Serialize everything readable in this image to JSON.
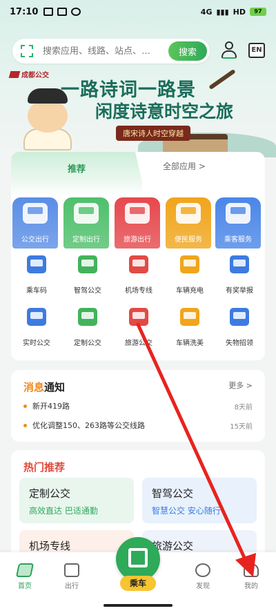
{
  "status": {
    "time": "17:10",
    "network": "4G",
    "hd": "HD",
    "battery": "97"
  },
  "search": {
    "placeholder": "搜索应用、线路、站点、…",
    "button": "搜索",
    "lang": "EN"
  },
  "banner": {
    "logo": "成都公交",
    "title_line1": "一路诗词一路景",
    "title_line2": "闲度诗意时空之旅",
    "subtitle": "唐宋诗人时空穿越"
  },
  "tabs": {
    "recommend": "推荐",
    "all": "全部应用 >"
  },
  "featured": [
    {
      "label": "公交出行",
      "color": "#5a8ee6"
    },
    {
      "label": "定制出行",
      "color": "#4fbf6c"
    },
    {
      "label": "旅游出行",
      "color": "#e5484d"
    },
    {
      "label": "便民服务",
      "color": "#f0a51c"
    },
    {
      "label": "乘客服务",
      "color": "#4a86e8"
    }
  ],
  "services_row1": [
    {
      "label": "乘车码",
      "color": "#3d7be0"
    },
    {
      "label": "智驾公交",
      "color": "#43b35b"
    },
    {
      "label": "机场专线",
      "color": "#e24a44"
    },
    {
      "label": "车辆充电",
      "color": "#f0a51c"
    },
    {
      "label": "有奖举报",
      "color": "#3d7be0"
    }
  ],
  "services_row2": [
    {
      "label": "实时公交",
      "color": "#3d7be0"
    },
    {
      "label": "定制公交",
      "color": "#43b35b"
    },
    {
      "label": "旅游公交",
      "color": "#e24a44"
    },
    {
      "label": "车辆洗美",
      "color": "#f0a51c"
    },
    {
      "label": "失物招领",
      "color": "#3d7be0"
    }
  ],
  "notice": {
    "title_hl": "消息",
    "title_rest": "通知",
    "more": "更多 >",
    "items": [
      {
        "text": "新开419路",
        "time": "8天前"
      },
      {
        "text": "优化调整150、263路等公交线路",
        "time": "15天前"
      }
    ]
  },
  "hot": {
    "title": "热门推荐",
    "items": [
      {
        "title": "定制公交",
        "sub": "高效直达 巴适通勤",
        "sub_color": "#2eaa59",
        "bg": "#e8f6ee"
      },
      {
        "title": "智驾公交",
        "sub": "智慧公交 安心随行",
        "sub_color": "#3d7be0",
        "bg": "#e8f1fc"
      },
      {
        "title": "机场专线",
        "sub": "",
        "sub_color": "#e24a44",
        "bg": "#fdf0ea"
      },
      {
        "title": "旅游公交",
        "sub": "",
        "sub_color": "#3d7be0",
        "bg": "#eef2fb"
      }
    ]
  },
  "tabbar": {
    "home": "首页",
    "travel": "出行",
    "ride": "乘车",
    "discover": "发现",
    "mine": "我的"
  },
  "annotation": {
    "arrow_color": "#e8231f"
  }
}
